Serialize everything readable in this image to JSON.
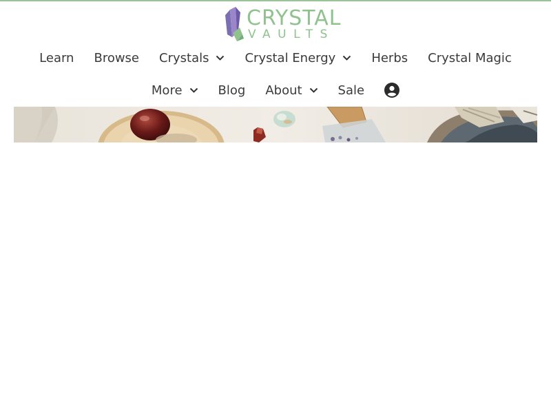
{
  "header": {
    "logo": {
      "line1": "CRYSTAL",
      "line2": "VAULTS",
      "color": "#8fc28d"
    },
    "accent_rule_color": "#9bc39a"
  },
  "nav": {
    "row1": [
      {
        "label": "Learn",
        "dropdown": false
      },
      {
        "label": "Browse",
        "dropdown": false
      },
      {
        "label": "Crystals",
        "dropdown": true
      },
      {
        "label": "Crystal Energy",
        "dropdown": true
      },
      {
        "label": "Herbs",
        "dropdown": false
      },
      {
        "label": "Crystal Magic",
        "dropdown": false
      }
    ],
    "row2": [
      {
        "label": "More",
        "dropdown": true
      },
      {
        "label": "Blog",
        "dropdown": false
      },
      {
        "label": "About",
        "dropdown": true
      },
      {
        "label": "Sale",
        "dropdown": false
      }
    ],
    "account_icon": "user-circle-icon"
  },
  "hero": {
    "image": "crystals-flatlay-banner"
  }
}
